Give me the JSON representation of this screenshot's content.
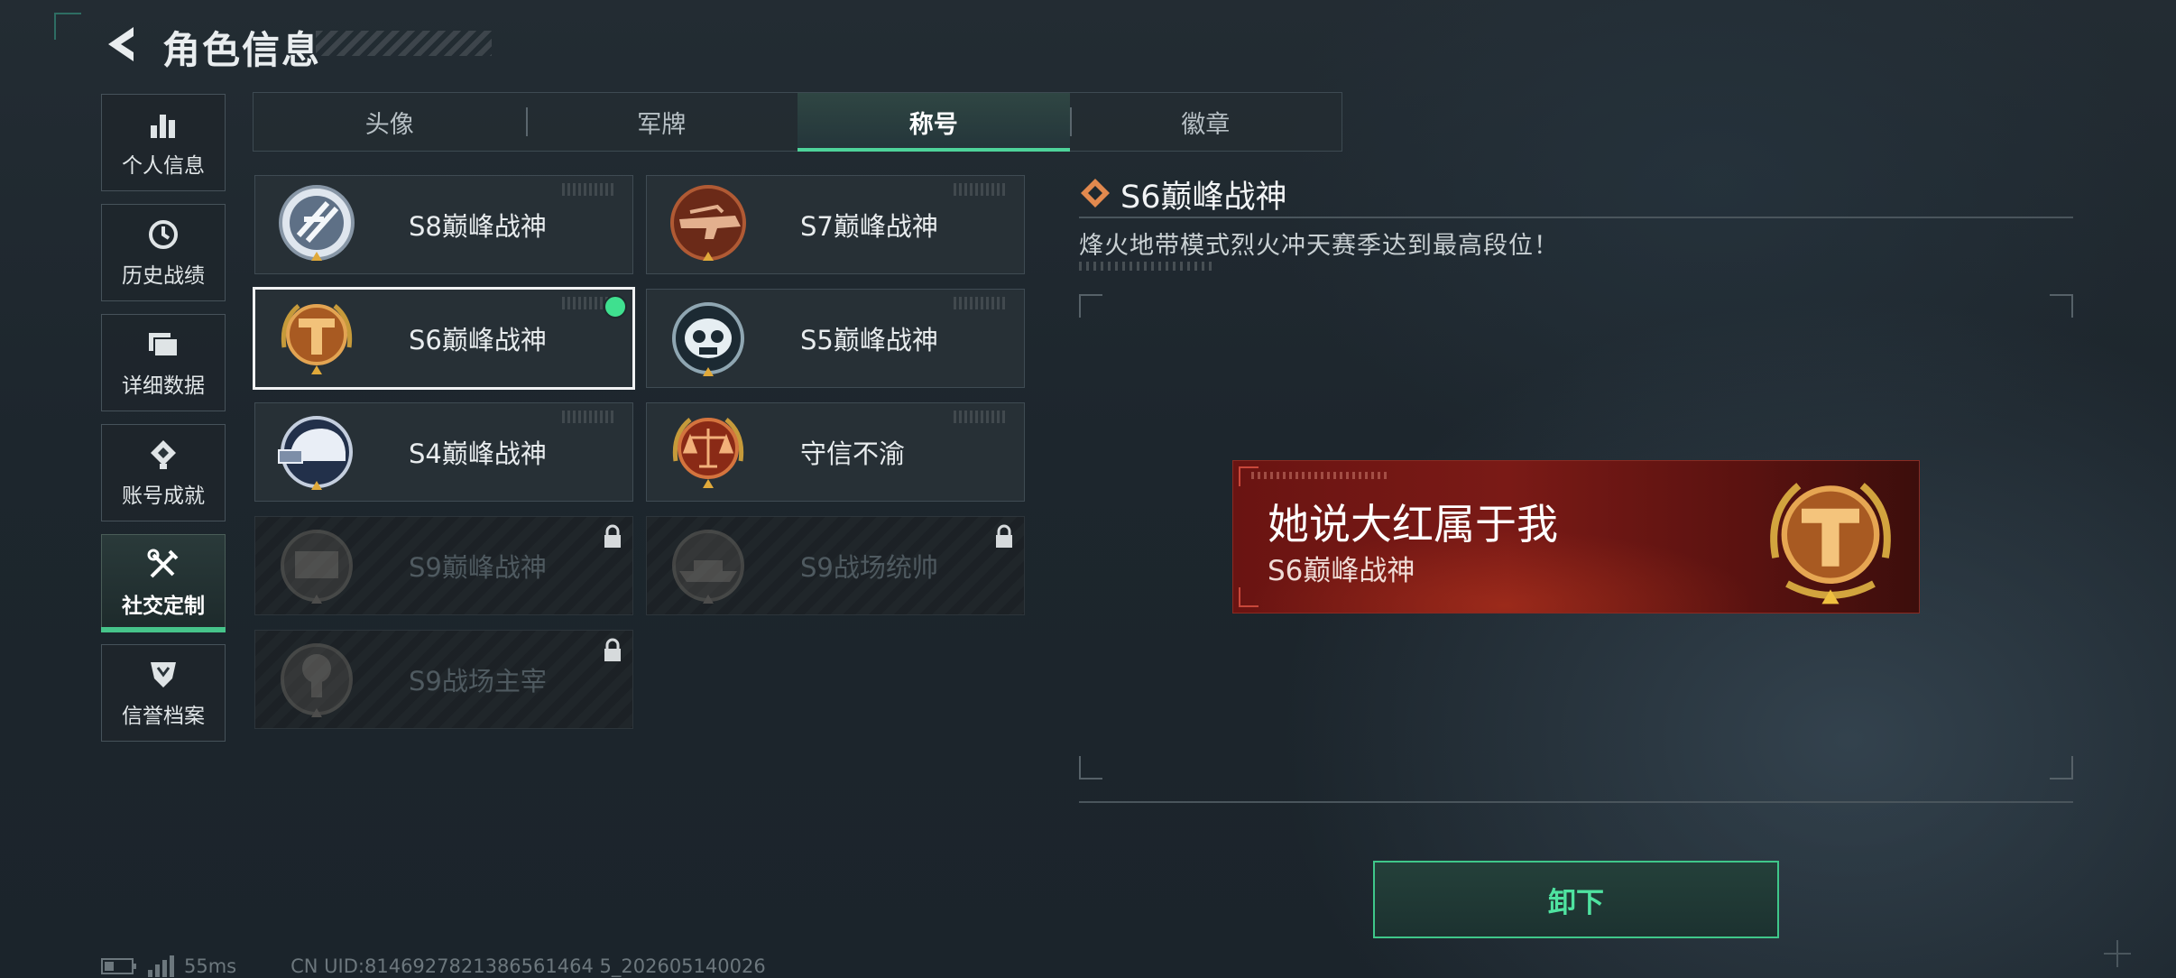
{
  "header": {
    "title": "角色信息"
  },
  "sidebar": {
    "items": [
      {
        "label": "个人信息",
        "icon": "bar-chart-icon"
      },
      {
        "label": "历史战绩",
        "icon": "clock-history-icon"
      },
      {
        "label": "详细数据",
        "icon": "folder-icon"
      },
      {
        "label": "账号成就",
        "icon": "achievement-icon"
      },
      {
        "label": "社交定制",
        "icon": "tools-icon",
        "active": true
      },
      {
        "label": "信誉档案",
        "icon": "shield-badge-icon"
      }
    ]
  },
  "tabs": [
    {
      "label": "头像"
    },
    {
      "label": "军牌"
    },
    {
      "label": "称号",
      "active": true
    },
    {
      "label": "徽章"
    }
  ],
  "titles": [
    {
      "name": "S8巅峰战神",
      "locked": false
    },
    {
      "name": "S7巅峰战神",
      "locked": false
    },
    {
      "name": "S6巅峰战神",
      "locked": false,
      "selected": true,
      "equipped": true
    },
    {
      "name": "S5巅峰战神",
      "locked": false
    },
    {
      "name": "S4巅峰战神",
      "locked": false
    },
    {
      "name": "守信不渝",
      "locked": false
    },
    {
      "name": "S9巅峰战神",
      "locked": true
    },
    {
      "name": "S9战场统帅",
      "locked": true
    },
    {
      "name": "S9战场主宰",
      "locked": true
    }
  ],
  "detail": {
    "title": "S6巅峰战神",
    "description": "烽火地带模式烈火冲天赛季达到最高段位！",
    "preview": {
      "player_name": "她说大红属于我",
      "title": "S6巅峰战神"
    },
    "unequip_label": "卸下"
  },
  "status": {
    "ping": "55ms",
    "uid": "CN UID:8146927821386561464 5_202605140026"
  },
  "colors": {
    "accent": "#46c48a",
    "equipped_dot": "#3fe08f",
    "plate_red": "#7a1a16"
  }
}
